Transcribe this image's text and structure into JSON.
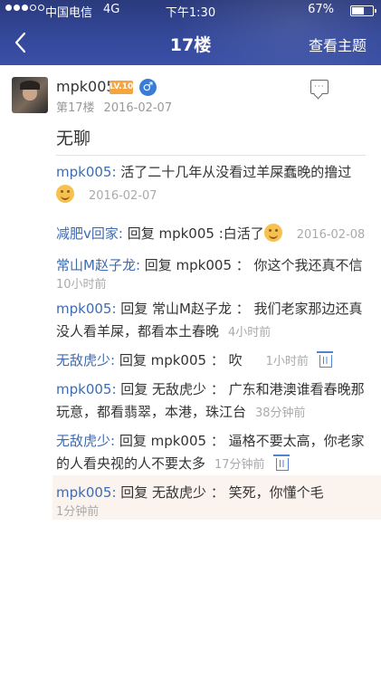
{
  "status_bar": {
    "carrier": "中国电信",
    "network": "4G",
    "time": "下午1:30",
    "battery_percent": "67%",
    "battery_level": 0.67
  },
  "nav": {
    "back_icon": "chevron-left-icon",
    "title": "17楼",
    "right_action": "查看主题"
  },
  "post": {
    "username": "mpk005",
    "level_badge": "LV.10",
    "gender_icon": "♂",
    "floor": "第17楼",
    "date": "2016-02-07",
    "body": "无聊"
  },
  "replies": [
    {
      "author": "mpk005:",
      "text": " 活了二十几年从没看过羊屎蠢晚的撸过",
      "time": "2016-02-07",
      "emoji": true
    },
    {
      "author": "减肥v回家:",
      "text": " 回复 mpk005 :白活了",
      "time": "2016-02-08",
      "emoji": true
    },
    {
      "author": "常山M赵子龙:",
      "text": " 回复 mpk005 ： 你这个我还真不信",
      "time": "10小时前"
    },
    {
      "author": "mpk005:",
      "text": " 回复 常山M赵子龙 ： 我们老家那边还真没人看羊屎，都看本土春晚",
      "time": "4小时前"
    },
    {
      "author": "无敌虎少:",
      "text": " 回复 mpk005 ： 吹",
      "time": "1小时前",
      "trash": true
    },
    {
      "author": "mpk005:",
      "text": " 回复 无敌虎少 ： 广东和港澳谁看春晚那玩意，都看翡翠，本港，珠江台",
      "time": "38分钟前"
    },
    {
      "author": "无敌虎少:",
      "text": " 回复 mpk005 ： 逼格不要太高，你老家的人看央视的人不要太多",
      "time": "17分钟前",
      "trash": true
    },
    {
      "author": "mpk005:",
      "text": " 回复 无敌虎少 ： 笑死，你懂个毛",
      "time": "1分钟前"
    }
  ]
}
